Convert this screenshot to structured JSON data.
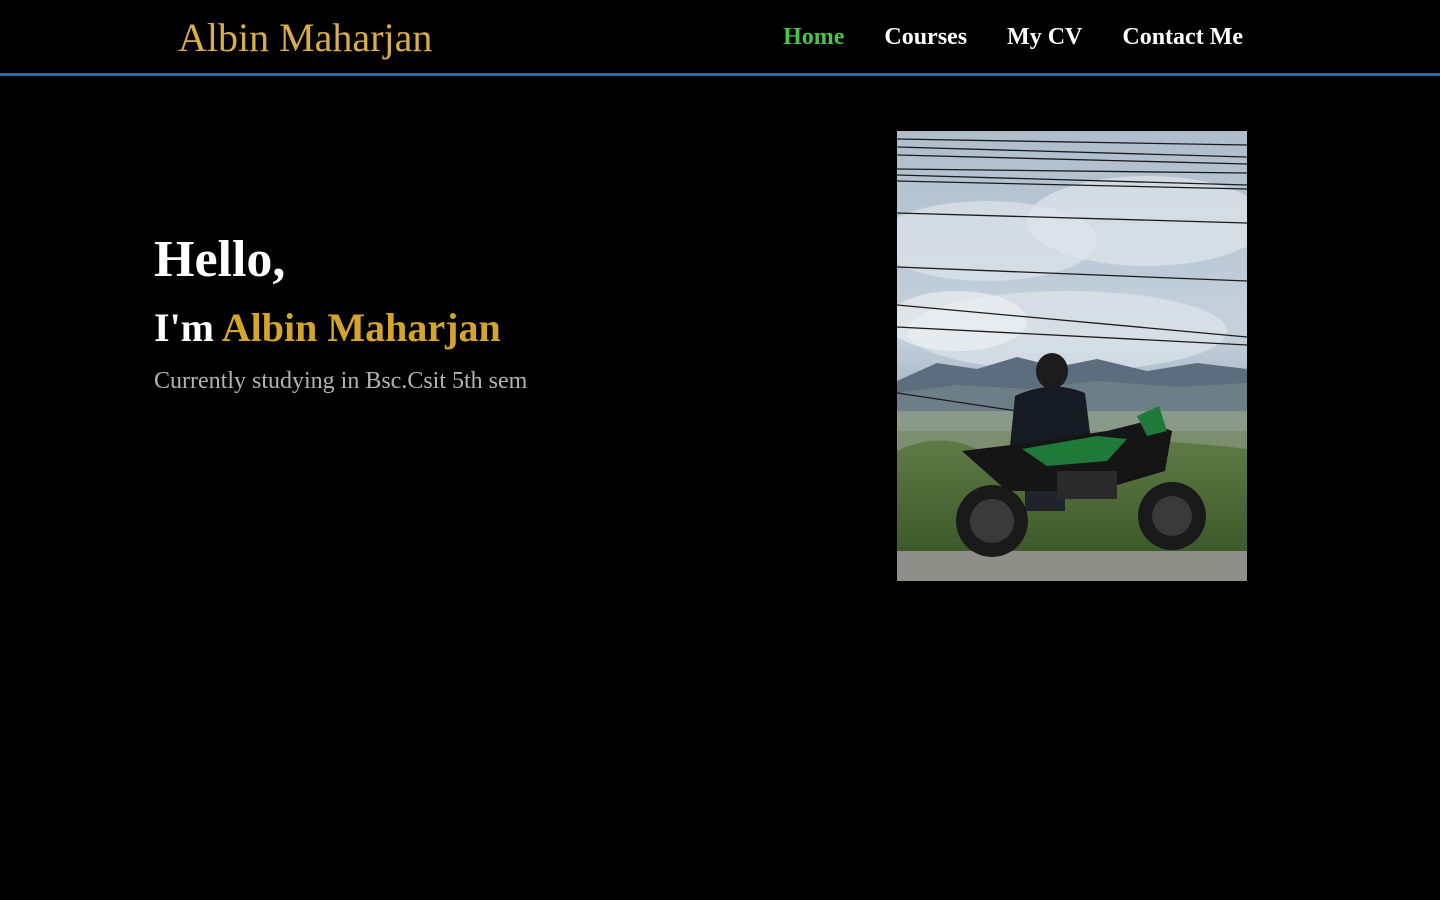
{
  "brand": "Albin Maharjan",
  "nav": {
    "items": [
      {
        "label": "Home",
        "active": true
      },
      {
        "label": "Courses",
        "active": false
      },
      {
        "label": "My CV",
        "active": false
      },
      {
        "label": "Contact Me",
        "active": false
      }
    ]
  },
  "hero": {
    "greeting": "Hello,",
    "intro_prefix": "I'm ",
    "name": "Albin Maharjan",
    "subtitle": "Currently studying in Bsc.Csit 5th sem"
  },
  "colors": {
    "background": "#000000",
    "brand": "#d8ad4a",
    "name_accent": "#d4a52a",
    "nav_active": "#4cc24a",
    "nav_border": "#2f6aa0",
    "subtitle": "#b3b3b3"
  }
}
